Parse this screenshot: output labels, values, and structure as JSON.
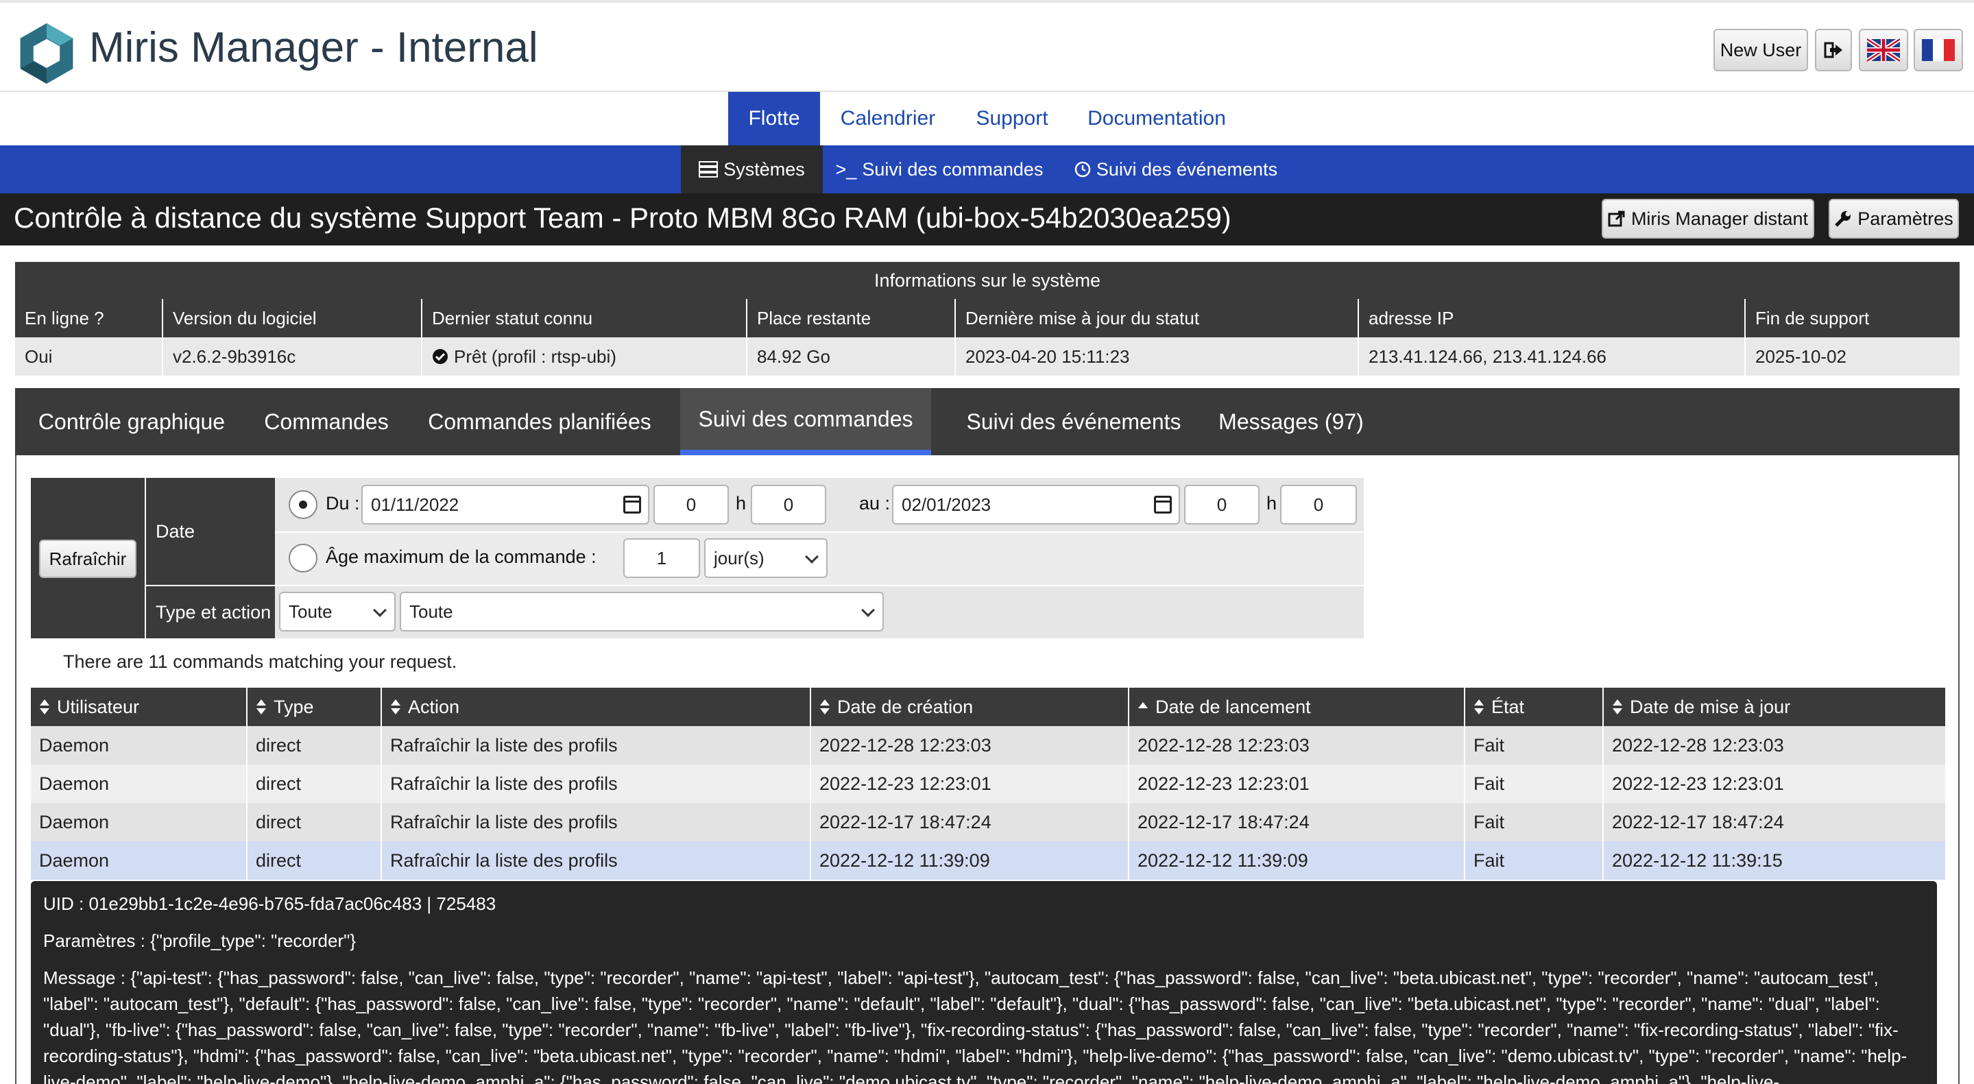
{
  "app": {
    "title": "Miris Manager - Internal",
    "new_user_label": "New User"
  },
  "main_nav": [
    "Flotte",
    "Calendrier",
    "Support",
    "Documentation"
  ],
  "sub_nav": [
    "Systèmes",
    "Suivi des commandes",
    "Suivi des événements"
  ],
  "page": {
    "title": "Contrôle à distance du système Support Team - Proto MBM 8Go RAM (ubi-box-54b2030ea259)",
    "remote_button": "Miris Manager distant",
    "settings_button": "Paramètres"
  },
  "system_info": {
    "caption": "Informations sur le système",
    "headers": [
      "En ligne ?",
      "Version du logiciel",
      "Dernier statut connu",
      "Place restante",
      "Dernière mise à jour du statut",
      "adresse IP",
      "Fin de support"
    ],
    "values": [
      "Oui",
      "v2.6.2-9b3916c",
      "Prêt (profil : rtsp-ubi)",
      "84.92 Go",
      "2023-04-20 15:11:23",
      "213.41.124.66, 213.41.124.66",
      "2025-10-02"
    ]
  },
  "tabs": [
    "Contrôle graphique",
    "Commandes",
    "Commandes planifiées",
    "Suivi des commandes",
    "Suivi des événements",
    "Messages (97)"
  ],
  "filter": {
    "refresh_label": "Rafraîchir",
    "date_label": "Date",
    "from_label": "Du :",
    "from_date": "01/11/2022",
    "from_hour": "0",
    "from_min": "0",
    "h_label": "h",
    "to_label": "au :",
    "to_date": "02/01/2023",
    "to_hour": "0",
    "to_min": "0",
    "max_age_label": "Âge maximum de la commande :",
    "max_age_value": "1",
    "max_age_unit": "jour(s)",
    "type_action_label": "Type et action",
    "type_select": "Toute",
    "action_select": "Toute"
  },
  "match_text": "There are 11 commands matching your request.",
  "commands": {
    "headers": [
      "Utilisateur",
      "Type",
      "Action",
      "Date de création",
      "Date de lancement",
      "État",
      "Date de mise à jour"
    ],
    "rows": [
      [
        "Daemon",
        "direct",
        "Rafraîchir la liste des profils",
        "2022-12-28 12:23:03",
        "2022-12-28 12:23:03",
        "Fait",
        "2022-12-28 12:23:03"
      ],
      [
        "Daemon",
        "direct",
        "Rafraîchir la liste des profils",
        "2022-12-23 12:23:01",
        "2022-12-23 12:23:01",
        "Fait",
        "2022-12-23 12:23:01"
      ],
      [
        "Daemon",
        "direct",
        "Rafraîchir la liste des profils",
        "2022-12-17 18:47:24",
        "2022-12-17 18:47:24",
        "Fait",
        "2022-12-17 18:47:24"
      ],
      [
        "Daemon",
        "direct",
        "Rafraîchir la liste des profils",
        "2022-12-12 11:39:09",
        "2022-12-12 11:39:09",
        "Fait",
        "2022-12-12 11:39:15"
      ]
    ]
  },
  "details": {
    "uid_label": "UID :",
    "uid_value": "01e29bb1-1c2e-4e96-b765-fda7ac06c483 | 725483",
    "params_label": "Paramètres :",
    "params_value": "{\"profile_type\": \"recorder\"}",
    "message_label": "Message :",
    "message_value": "{\"api-test\": {\"has_password\": false, \"can_live\": false, \"type\": \"recorder\", \"name\": \"api-test\", \"label\": \"api-test\"}, \"autocam_test\": {\"has_password\": false, \"can_live\": \"beta.ubicast.net\", \"type\": \"recorder\", \"name\": \"autocam_test\", \"label\": \"autocam_test\"}, \"default\": {\"has_password\": false, \"can_live\": false, \"type\": \"recorder\", \"name\": \"default\", \"label\": \"default\"}, \"dual\": {\"has_password\": false, \"can_live\": \"beta.ubicast.net\", \"type\": \"recorder\", \"name\": \"dual\", \"label\": \"dual\"}, \"fb-live\": {\"has_password\": false, \"can_live\": false, \"type\": \"recorder\", \"name\": \"fb-live\", \"label\": \"fb-live\"}, \"fix-recording-status\": {\"has_password\": false, \"can_live\": false, \"type\": \"recorder\", \"name\": \"fix-recording-status\", \"label\": \"fix-recording-status\"}, \"hdmi\": {\"has_password\": false, \"can_live\": \"beta.ubicast.net\", \"type\": \"recorder\", \"name\": \"hdmi\", \"label\": \"hdmi\"}, \"help-live-demo\": {\"has_password\": false, \"can_live\": \"demo.ubicast.tv\", \"type\": \"recorder\", \"name\": \"help-live-demo\", \"label\": \"help-live-demo\"}, \"help-live-demo_amphi_a\": {\"has_password\": false, \"can_live\": \"demo.ubicast.tv\", \"type\": \"recorder\", \"name\": \"help-live-demo_amphi_a\", \"label\": \"help-live-demo_amphi_a\"}, \"help-live-"
  },
  "colors": {
    "nav_blue": "#2347b7",
    "dark_bar": "#1f1f1f",
    "table_header": "#3a3a3a",
    "selected_row": "#d2dcf3",
    "link_blue": "#1c49ad",
    "online_green": "#2a8a2a"
  }
}
